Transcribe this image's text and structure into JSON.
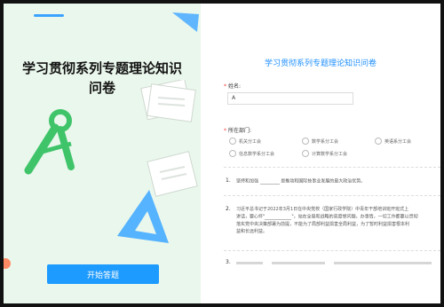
{
  "cover": {
    "title_line1": "学习贯彻系列专题理论知识",
    "title_line2": "问卷",
    "start_button": "开始答题"
  },
  "form": {
    "title": "学习贯彻系列专题理论知识问卷",
    "name_label": "姓名:",
    "name_value": "A",
    "dept_label": "所在部门:",
    "dept_options": [
      "机关分工会",
      "数学系分工会",
      "英语系分工会",
      "信息数学系分工会",
      "计算数学系分工会"
    ],
    "q1_num": "1.",
    "q1_pre": "坚持和加强",
    "q1_post": "是推动和国际技事业发展的最大政治优势。",
    "q2_num": "2.",
    "q2_line1": "习近平总书记于2022年3月1日在中央党校（国家行政学院）中青年干部培训班开班式上",
    "q2_line2": "讲话，要心怀\"",
    "q2_line3": "\"，站在全局和战略的高度想问题，办事情，一切工作都要以贯彻",
    "q2_line4": "落实党中央决策部署为前提，不能为了局部利益损害全局利益，为了暂时利益损害根本利",
    "q2_line5": "益和长远利益。",
    "q3_num": "3."
  },
  "colors": {
    "accent": "#1e9bff",
    "cover_bg": "#eaf7ec",
    "required": "#ff3b30"
  }
}
